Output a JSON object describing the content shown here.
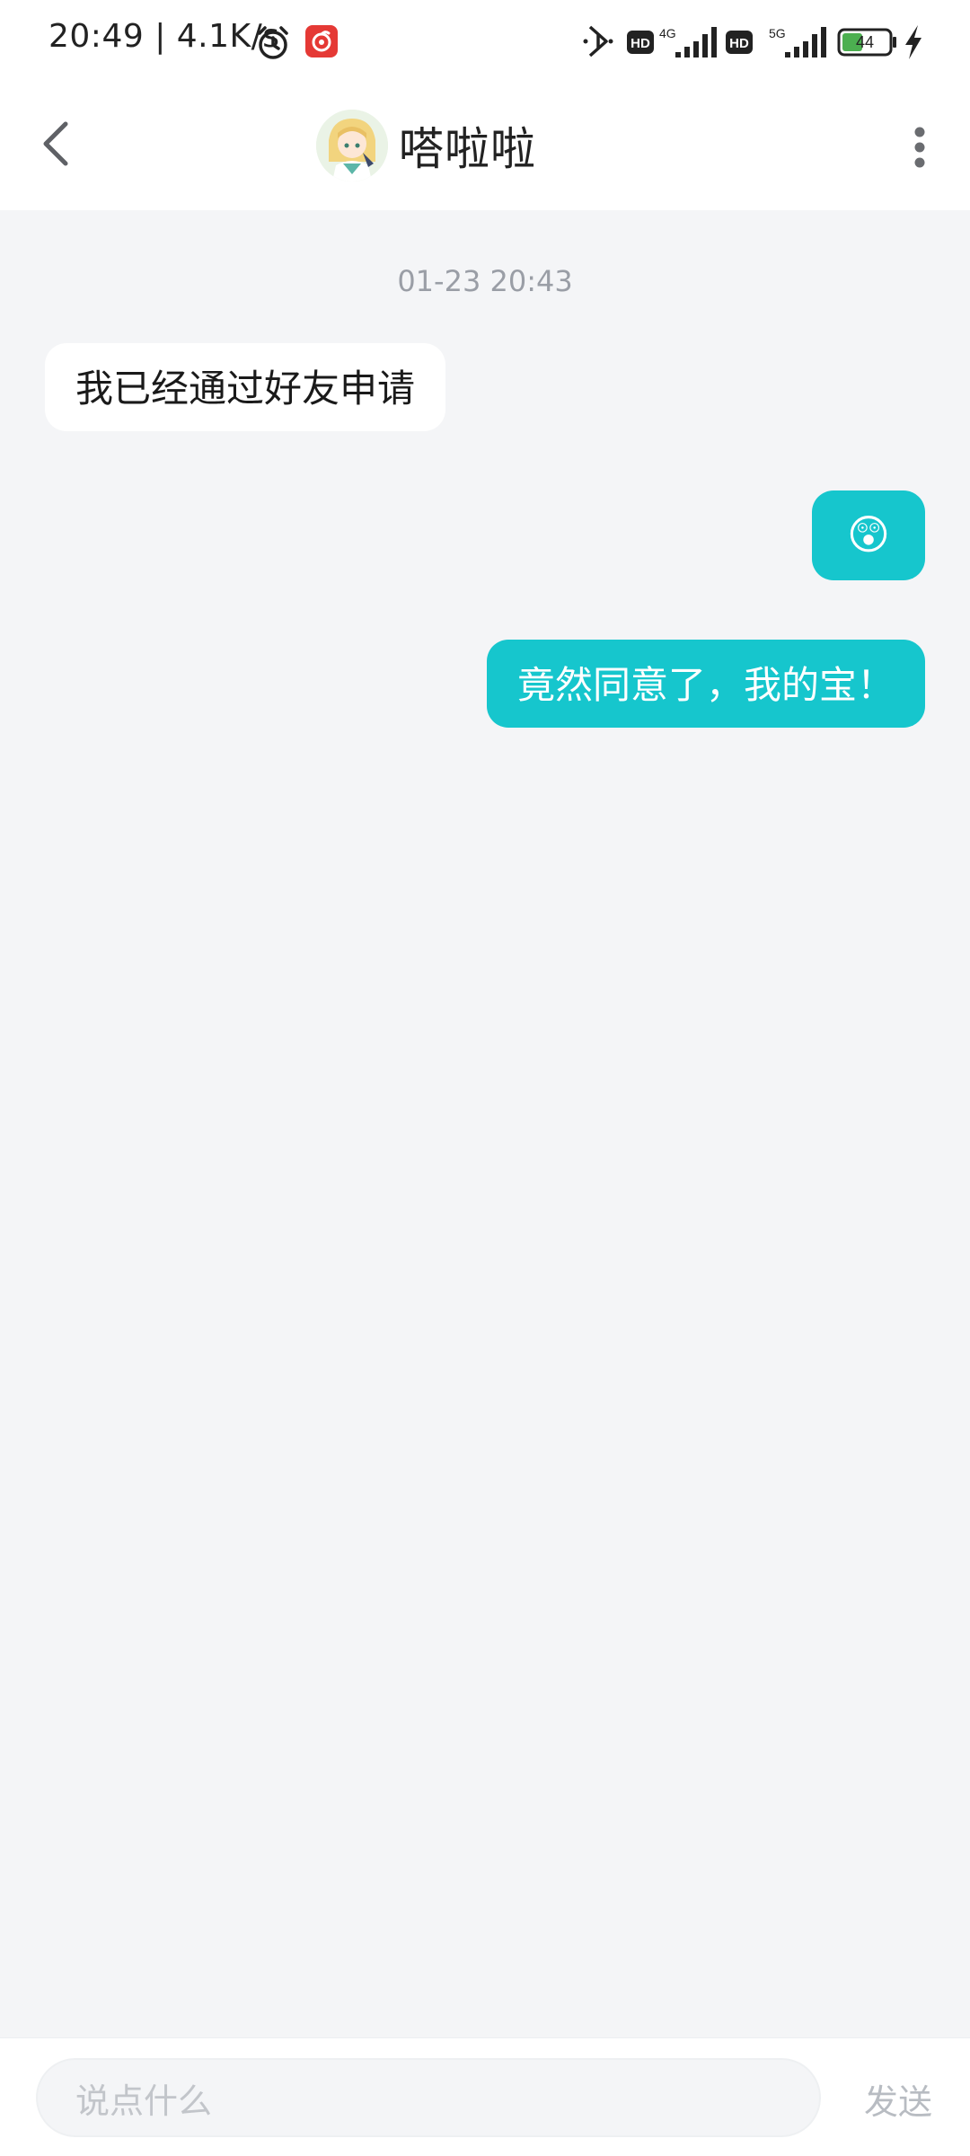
{
  "status_bar": {
    "time_speed": "20:49 | 4.1K/s",
    "icons": [
      "alarm-icon",
      "music-app-icon",
      "bluetooth-icon",
      "hd-icon",
      "signal-4g-icon",
      "hd-icon",
      "signal-5g-icon",
      "battery-icon",
      "charging-icon"
    ],
    "net_label_1": "4G",
    "net_label_2": "5G",
    "hd_label": "HD",
    "battery_level": "44"
  },
  "header": {
    "title": "嗒啦啦",
    "back_icon": "chevron-left-icon",
    "more_icon": "more-vertical-icon"
  },
  "chat": {
    "timestamp": "01-23 20:43",
    "messages": [
      {
        "direction": "in",
        "text": "我已经通过好友申请"
      },
      {
        "direction": "out",
        "emoji": "😲"
      },
      {
        "direction": "out",
        "text": "竟然同意了，我的宝！"
      }
    ]
  },
  "input": {
    "placeholder": "说点什么",
    "send_label": "发送"
  },
  "colors": {
    "accent": "#16c6cd",
    "background": "#f4f5f7",
    "incoming_bubble": "#ffffff"
  }
}
